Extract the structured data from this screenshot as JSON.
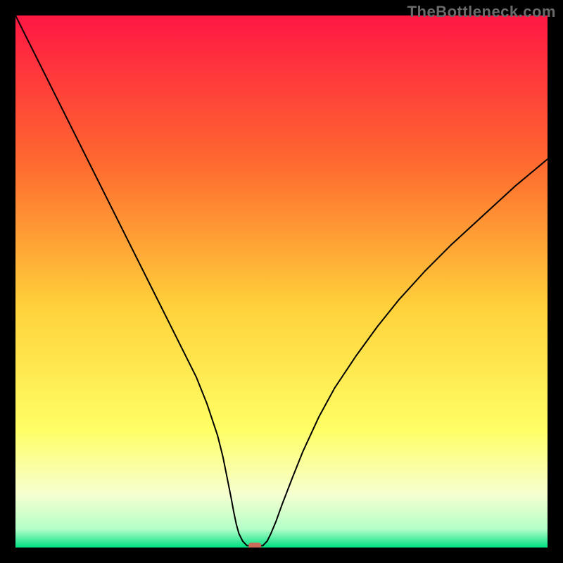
{
  "watermark": "TheBottleneck.com",
  "chart_data": {
    "type": "line",
    "title": "",
    "xlabel": "",
    "ylabel": "",
    "xlim": [
      0,
      100
    ],
    "ylim": [
      0,
      100
    ],
    "legend": false,
    "grid": false,
    "background": {
      "type": "vertical_gradient",
      "stops": [
        {
          "pos": 0.0,
          "color": "#ff1744"
        },
        {
          "pos": 0.28,
          "color": "#ff6a2f"
        },
        {
          "pos": 0.55,
          "color": "#ffd23b"
        },
        {
          "pos": 0.78,
          "color": "#ffff66"
        },
        {
          "pos": 0.9,
          "color": "#f6ffd0"
        },
        {
          "pos": 0.965,
          "color": "#b4ffc8"
        },
        {
          "pos": 1.0,
          "color": "#00e082"
        }
      ]
    },
    "series": [
      {
        "name": "bottleneck-curve",
        "stroke": "#000000",
        "stroke_width": 2,
        "x": [
          0,
          5,
          10,
          14,
          18,
          22,
          25,
          28,
          30,
          32,
          34,
          36,
          38,
          39,
          39.8,
          40.5,
          41,
          41.5,
          42,
          42.7,
          43.5,
          46.5,
          47.3,
          48,
          49,
          50,
          52,
          54,
          57,
          60,
          64,
          68,
          72,
          77,
          82,
          88,
          94,
          100
        ],
        "values": [
          100,
          90,
          80,
          72,
          64,
          56,
          50,
          44,
          40,
          36,
          32,
          27,
          21,
          17,
          13,
          9.5,
          6.8,
          4.4,
          2.6,
          1.2,
          0.35,
          0.35,
          1.2,
          2.6,
          5,
          7.8,
          13,
          18,
          24.5,
          30,
          36,
          41.5,
          46.5,
          52,
          57,
          62.5,
          68,
          73
        ]
      }
    ],
    "marker": {
      "name": "optimal-point",
      "x": 45,
      "y": 0,
      "color": "#c96a5a",
      "shape": "rounded-rect"
    }
  }
}
